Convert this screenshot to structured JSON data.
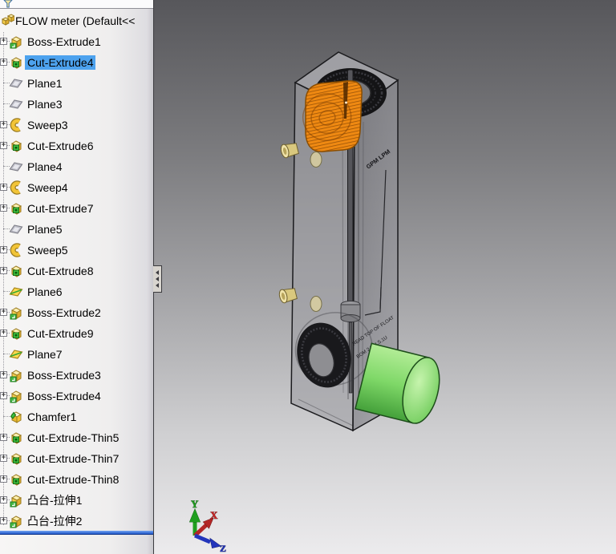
{
  "feature_tree": {
    "filter_bar": {
      "icon": "funnel-icon"
    },
    "root_label": "FLOW meter  (Default<<",
    "selection_color": "#4da2ee",
    "rollback_color": "#1f56c8",
    "items": [
      {
        "label": "Boss-Extrude1",
        "icon": "boss-extrude",
        "expandable": true,
        "selected": false
      },
      {
        "label": "Cut-Extrude4",
        "icon": "cut-extrude",
        "expandable": true,
        "selected": true
      },
      {
        "label": "Plane1",
        "icon": "plane",
        "expandable": false,
        "selected": false
      },
      {
        "label": "Plane3",
        "icon": "plane",
        "expandable": false,
        "selected": false
      },
      {
        "label": "Sweep3",
        "icon": "sweep",
        "expandable": true,
        "selected": false
      },
      {
        "label": "Cut-Extrude6",
        "icon": "cut-extrude",
        "expandable": true,
        "selected": false
      },
      {
        "label": "Plane4",
        "icon": "plane",
        "expandable": false,
        "selected": false
      },
      {
        "label": "Sweep4",
        "icon": "sweep",
        "expandable": true,
        "selected": false
      },
      {
        "label": "Cut-Extrude7",
        "icon": "cut-extrude",
        "expandable": true,
        "selected": false
      },
      {
        "label": "Plane5",
        "icon": "plane",
        "expandable": false,
        "selected": false
      },
      {
        "label": "Sweep5",
        "icon": "sweep",
        "expandable": true,
        "selected": false
      },
      {
        "label": "Cut-Extrude8",
        "icon": "cut-extrude",
        "expandable": true,
        "selected": false
      },
      {
        "label": "Plane6",
        "icon": "plane-gold",
        "expandable": false,
        "selected": false
      },
      {
        "label": "Boss-Extrude2",
        "icon": "boss-extrude",
        "expandable": true,
        "selected": false
      },
      {
        "label": "Cut-Extrude9",
        "icon": "cut-extrude",
        "expandable": true,
        "selected": false
      },
      {
        "label": "Plane7",
        "icon": "plane-gold",
        "expandable": false,
        "selected": false
      },
      {
        "label": "Boss-Extrude3",
        "icon": "boss-extrude",
        "expandable": true,
        "selected": false
      },
      {
        "label": "Boss-Extrude4",
        "icon": "boss-extrude",
        "expandable": true,
        "selected": false
      },
      {
        "label": "Chamfer1",
        "icon": "chamfer",
        "expandable": false,
        "selected": false
      },
      {
        "label": "Cut-Extrude-Thin5",
        "icon": "cut-extrude",
        "expandable": true,
        "selected": false
      },
      {
        "label": "Cut-Extrude-Thin7",
        "icon": "cut-extrude",
        "expandable": true,
        "selected": false
      },
      {
        "label": "Cut-Extrude-Thin8",
        "icon": "cut-extrude",
        "expandable": true,
        "selected": false
      },
      {
        "label": "凸台-拉伸1",
        "icon": "boss-extrude",
        "expandable": true,
        "selected": false
      },
      {
        "label": "凸台-拉伸2",
        "icon": "boss-extrude",
        "expandable": true,
        "selected": false
      }
    ]
  },
  "viewport": {
    "background_top": "#57575b",
    "background_bottom": "#ecebed",
    "triad": {
      "x_label": "X",
      "y_label": "Y",
      "z_label": "Z",
      "x_color": "#c22424",
      "y_color": "#1f9e1f",
      "z_color": "#2335bb"
    },
    "model": {
      "name": "FLOW meter",
      "side_scale_label": "GPM  LPM",
      "face_label_line1": "READ TOP OF FLOAT",
      "face_label_line2": "BOM 2.3GLS.1U",
      "knob_color": "#ef8912",
      "outlet_cylinder_color": "#7fd868",
      "fitting_color": "#ddcc84"
    }
  }
}
